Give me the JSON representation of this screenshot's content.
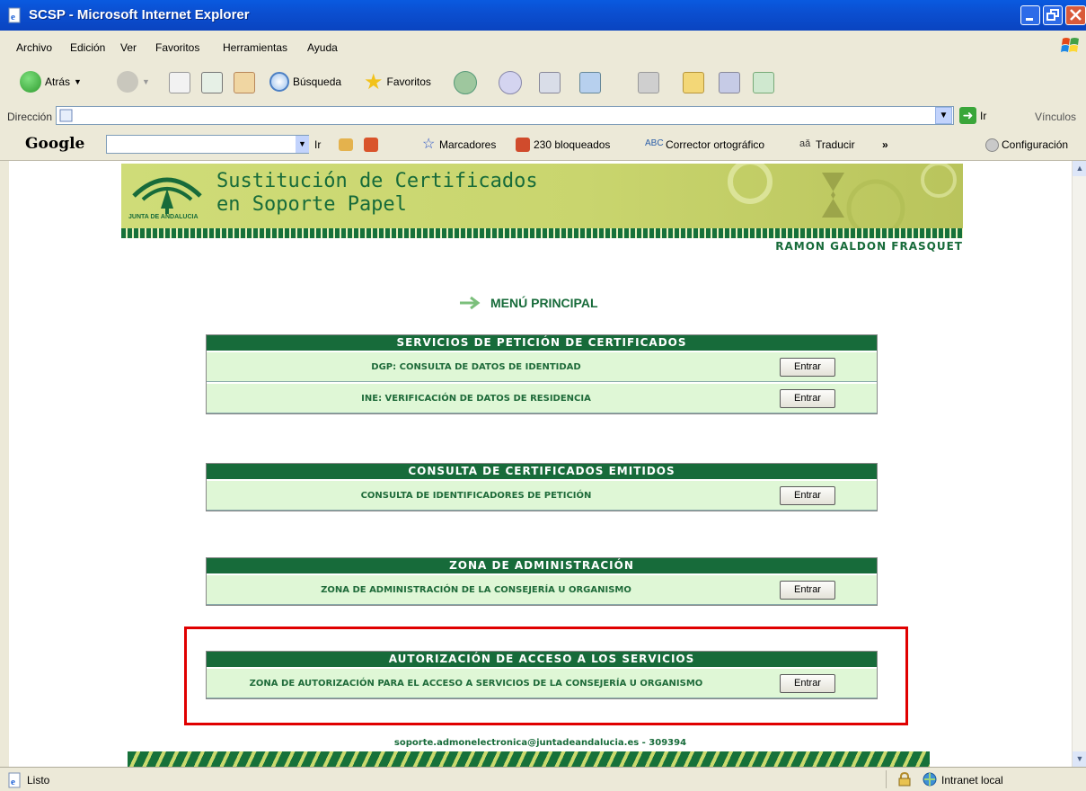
{
  "window": {
    "title": "SCSP - Microsoft Internet Explorer"
  },
  "menu": [
    "Archivo",
    "Edición",
    "Ver",
    "Favoritos",
    "Herramientas",
    "Ayuda"
  ],
  "toolbar": {
    "back": "Atrás",
    "search": "Búsqueda",
    "favorites": "Favoritos"
  },
  "address": {
    "label": "Dirección",
    "go": "Ir",
    "links": "Vínculos"
  },
  "google_bar": {
    "logo": "Google",
    "go": "Ir",
    "bookmarks": "Marcadores",
    "blocked": "230 bloqueados",
    "spell": "Corrector ortográfico",
    "translate": "Traducir",
    "settings": "Configuración"
  },
  "page": {
    "banner_line1": "Sustitución de Certificados",
    "banner_line2": "en Soporte Papel",
    "logo_text": "JUNTA DE ANDALUCIA",
    "user": "RAMON GALDON FRASQUET",
    "menu_title": "MENÚ PRINCIPAL",
    "button_label": "Entrar",
    "sections": [
      {
        "title": "SERVICIOS DE PETICIÓN DE CERTIFICADOS",
        "rows": [
          "DGP: CONSULTA DE DATOS DE IDENTIDAD",
          "INE: VERIFICACIÓN DE DATOS DE RESIDENCIA"
        ]
      },
      {
        "title": "CONSULTA DE CERTIFICADOS EMITIDOS",
        "rows": [
          "CONSULTA DE IDENTIFICADORES DE PETICIÓN"
        ]
      },
      {
        "title": "ZONA DE ADMINISTRACIÓN",
        "rows": [
          "ZONA DE ADMINISTRACIÓN DE LA CONSEJERÍA U ORGANISMO"
        ]
      },
      {
        "title": "AUTORIZACIÓN DE ACCESO A LOS SERVICIOS",
        "rows": [
          "ZONA DE AUTORIZACIÓN PARA EL ACCESO A SERVICIOS DE LA CONSEJERÍA U ORGANISMO"
        ]
      }
    ],
    "footer": "soporte.admonelectronica@juntadeandalucia.es - 309394"
  },
  "status": {
    "text": "Listo",
    "zone": "Intranet local"
  },
  "colors": {
    "brand_green": "#176b3a",
    "row_bg": "#dff7d6",
    "highlight": "#e00000"
  }
}
